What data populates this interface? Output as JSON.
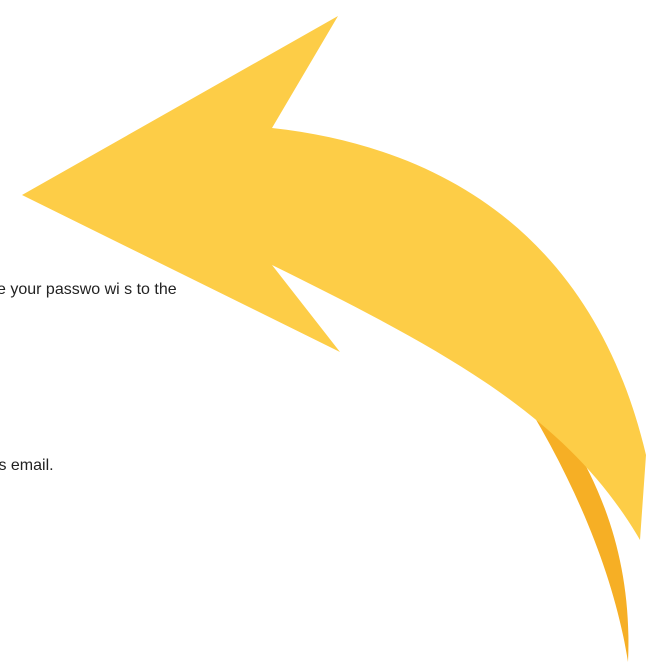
{
  "email": {
    "line_1": "e your passwo          wi                         s to the",
    "line_2": "his email."
  },
  "overlay": {
    "icon": "curved-back-arrow-icon",
    "arrow_front_color": "#fdcd47",
    "arrow_back_color": "#f6af25",
    "text_color": "#222222"
  }
}
